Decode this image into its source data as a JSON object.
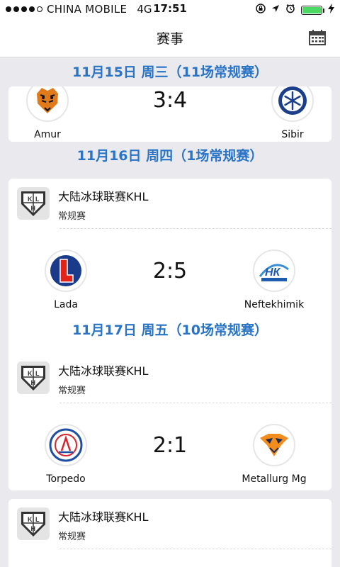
{
  "status_bar": {
    "carrier": "CHINA MOBILE",
    "network": "4G",
    "time": "17:51",
    "battery_level": 1.0
  },
  "nav": {
    "title": "赛事",
    "calendar_icon": "calendar-icon"
  },
  "days": [
    {
      "header": "11月15日 周三（11场常规赛）",
      "matches": [
        {
          "league": "",
          "round": "",
          "home": "Amur",
          "away": "Sibir",
          "score": "3:4"
        }
      ]
    },
    {
      "header": "11月16日 周四（1场常规赛）",
      "matches": [
        {
          "league": "大陆冰球联赛KHL",
          "round": "常规赛",
          "home": "Lada",
          "away": "Neftekhimik",
          "score": "2:5"
        }
      ]
    },
    {
      "header": "11月17日 周五（10场常规赛）",
      "matches": [
        {
          "league": "大陆冰球联赛KHL",
          "round": "常规赛",
          "home": "Torpedo",
          "away": "Metallurg Mg",
          "score": "2:1"
        },
        {
          "league": "大陆冰球联赛KHL",
          "round": "常规赛",
          "home": "",
          "away": "",
          "score": ""
        }
      ]
    }
  ],
  "colors": {
    "accent": "#2a74c6",
    "background": "#e9e9ee",
    "battery": "#4cd964"
  }
}
